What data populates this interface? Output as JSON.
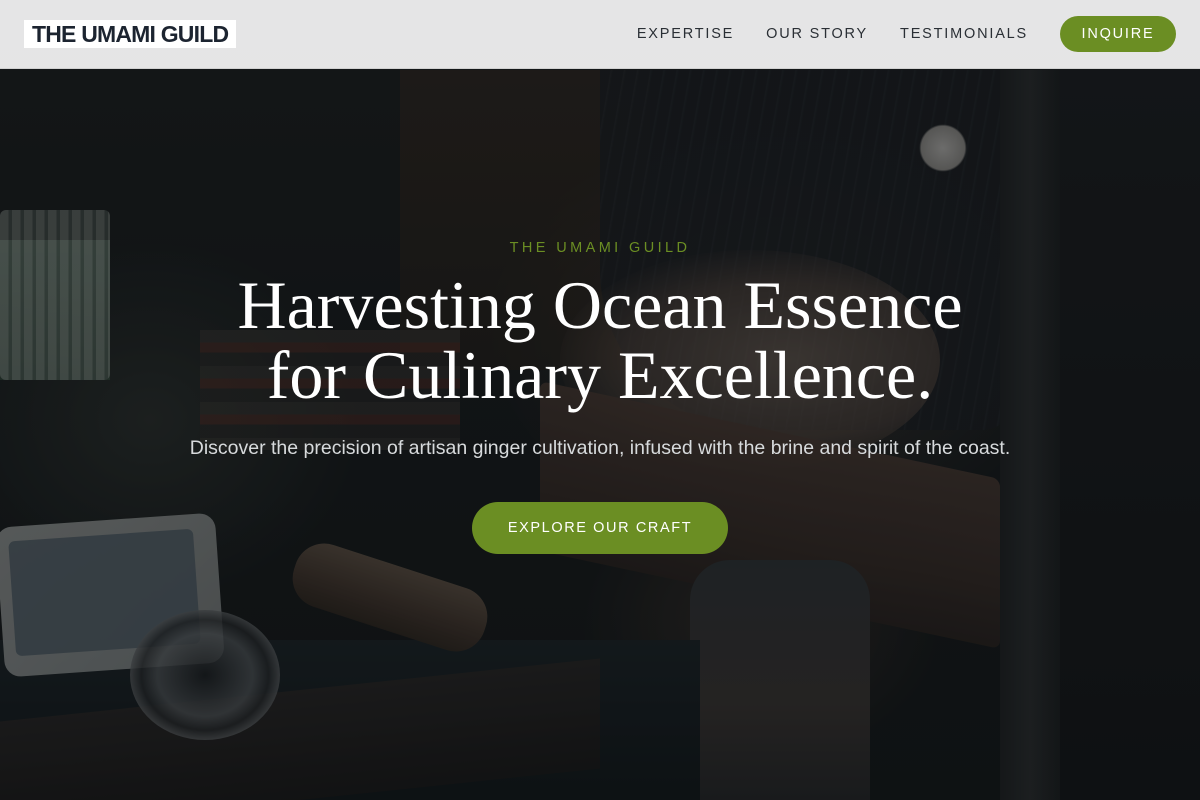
{
  "header": {
    "logo": "THE UMAMI GUILD",
    "nav": [
      {
        "label": "EXPERTISE"
      },
      {
        "label": "OUR STORY"
      },
      {
        "label": "TESTIMONIALS"
      }
    ],
    "cta_label": "INQUIRE"
  },
  "hero": {
    "eyebrow": "THE UMAMI GUILD",
    "headline_line1": "Harvesting Ocean Essence",
    "headline_line2": "for Culinary Excellence.",
    "subhead": "Discover the precision of artisan ginger cultivation, infused with the brine and spirit of the coast.",
    "cta_label": "EXPLORE OUR CRAFT",
    "background_image": "artisan workshop with hands working at an anvil, darkened overlay"
  },
  "colors": {
    "accent": "#6b8e23",
    "header_bg": "#eeeeee",
    "logo_text": "#1c2430",
    "nav_text": "#2a2f35",
    "headline": "#ffffff"
  }
}
